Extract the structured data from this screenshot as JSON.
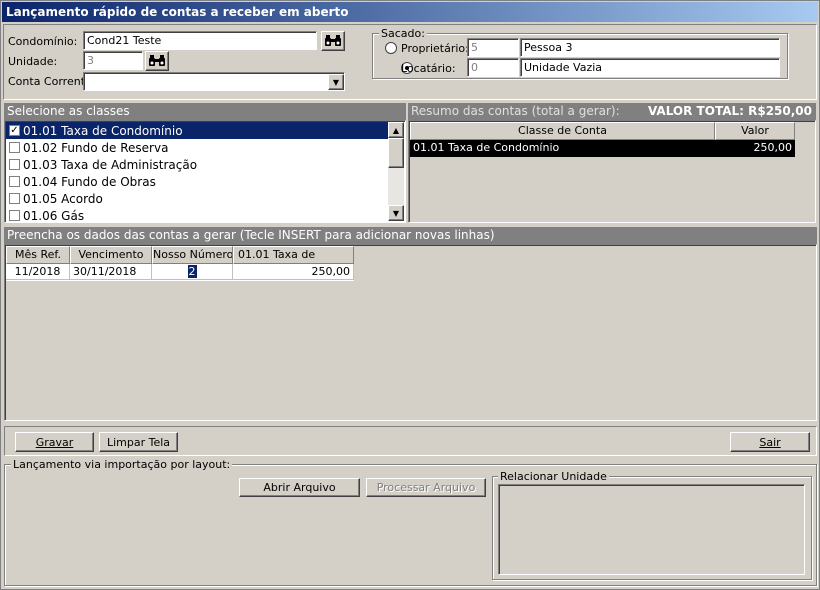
{
  "window": {
    "title": "Lançamento rápido de contas a receber em aberto"
  },
  "form": {
    "condominio_label": "Condomínio:",
    "condominio_value": "Cond21 Teste",
    "unidade_label": "Unidade:",
    "unidade_value": "3",
    "conta_corrente_label": "Conta Corrente:",
    "conta_corrente_value": ""
  },
  "sacado": {
    "legend": "Sacado:",
    "proprietario_label": "Proprietário:",
    "proprietario_code": "5",
    "proprietario_name": "Pessoa 3",
    "locatario_label": "Locatário:",
    "locatario_code": "0",
    "locatario_name": "Unidade Vazia",
    "selected": "locatario"
  },
  "classes": {
    "header": "Selecione as classes",
    "items": [
      {
        "label": "01.01 Taxa de Condomínio",
        "checked": true,
        "selected": true
      },
      {
        "label": "01.02 Fundo de Reserva",
        "checked": false,
        "selected": false
      },
      {
        "label": "01.03 Taxa de Administração",
        "checked": false,
        "selected": false
      },
      {
        "label": "01.04 Fundo de Obras",
        "checked": false,
        "selected": false
      },
      {
        "label": "01.05 Acordo",
        "checked": false,
        "selected": false
      },
      {
        "label": "01.06 Gás",
        "checked": false,
        "selected": false
      }
    ]
  },
  "resumo": {
    "header": "Resumo das contas (total a gerar):",
    "total": "VALOR TOTAL: R$250,00",
    "columns": [
      "Classe de Conta",
      "Valor"
    ],
    "rows": [
      [
        "01.01 Taxa de Condomínio",
        "250,00"
      ]
    ]
  },
  "dados": {
    "header": "Preencha os dados das contas a gerar (Tecle INSERT para adicionar novas linhas)",
    "columns": [
      "Mês Ref.",
      "Vencimento",
      "Nosso Número",
      "01.01 Taxa de"
    ],
    "rows": [
      [
        "11/2018",
        "30/11/2018",
        "2",
        "250,00"
      ]
    ]
  },
  "buttons": {
    "gravar": "Gravar",
    "limpar": "Limpar Tela",
    "sair": "Sair",
    "abrir": "Abrir Arquivo",
    "processar": "Processar Arquivo"
  },
  "importacao": {
    "legend": "Lançamento via importação por layout:",
    "relacionar_legend": "Relacionar Unidade"
  }
}
